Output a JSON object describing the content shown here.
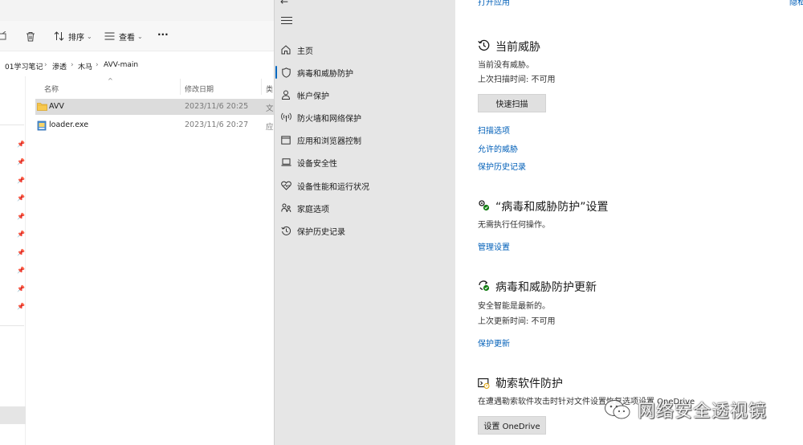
{
  "explorer": {
    "toolbar": {
      "sort_label": "排序",
      "view_label": "查看",
      "more_label": "···"
    },
    "address": [
      "01学习笔记",
      "渗透",
      "木马",
      "AVV-main"
    ],
    "columns": {
      "name": "名称",
      "date": "修改日期",
      "type": "类"
    },
    "files": [
      {
        "name": "AVV",
        "date": "2023/11/6 20:25",
        "type": "文",
        "icon": "folder-icon",
        "selected": true
      },
      {
        "name": "loader.exe",
        "date": "2023/11/6 20:27",
        "type": "应",
        "icon": "exe-icon",
        "selected": false
      }
    ]
  },
  "security": {
    "top_links": {
      "left": "打开应用",
      "right": "隐私"
    },
    "nav": [
      {
        "label": "主页",
        "icon": "home-icon"
      },
      {
        "label": "病毒和威胁防护",
        "icon": "shield-icon",
        "active": true
      },
      {
        "label": "帐户保护",
        "icon": "person-icon"
      },
      {
        "label": "防火墙和网络保护",
        "icon": "antenna-icon"
      },
      {
        "label": "应用和浏览器控制",
        "icon": "app-window-icon"
      },
      {
        "label": "设备安全性",
        "icon": "laptop-icon"
      },
      {
        "label": "设备性能和运行状况",
        "icon": "heart-pulse-icon"
      },
      {
        "label": "家庭选项",
        "icon": "family-icon"
      },
      {
        "label": "保护历史记录",
        "icon": "history-icon"
      }
    ],
    "current_threats": {
      "title": "当前威胁",
      "status": "当前没有威胁。",
      "last_scan": "上次扫描时间: 不可用",
      "quick_scan_button": "快速扫描",
      "links": [
        "扫描选项",
        "允许的威胁",
        "保护历史记录"
      ]
    },
    "settings": {
      "title": "“病毒和威胁防护”设置",
      "text": "无需执行任何操作。",
      "link": "管理设置"
    },
    "updates": {
      "title": "病毒和威胁防护更新",
      "text": "安全智能是最新的。",
      "last_update": "上次更新时间: 不可用",
      "link": "保护更新"
    },
    "ransomware": {
      "title": "勒索软件防护",
      "text": "在遭遇勒索软件攻击时针对文件设置恢复选项设置 OneDrive",
      "button": "设置 OneDrive"
    }
  },
  "watermark": {
    "text": "网络安全透视镜"
  },
  "colors": {
    "accent": "#0067c0",
    "link": "#005fb8",
    "sidebar_bg": "#e6e6e6",
    "status_green": "#107c10"
  }
}
